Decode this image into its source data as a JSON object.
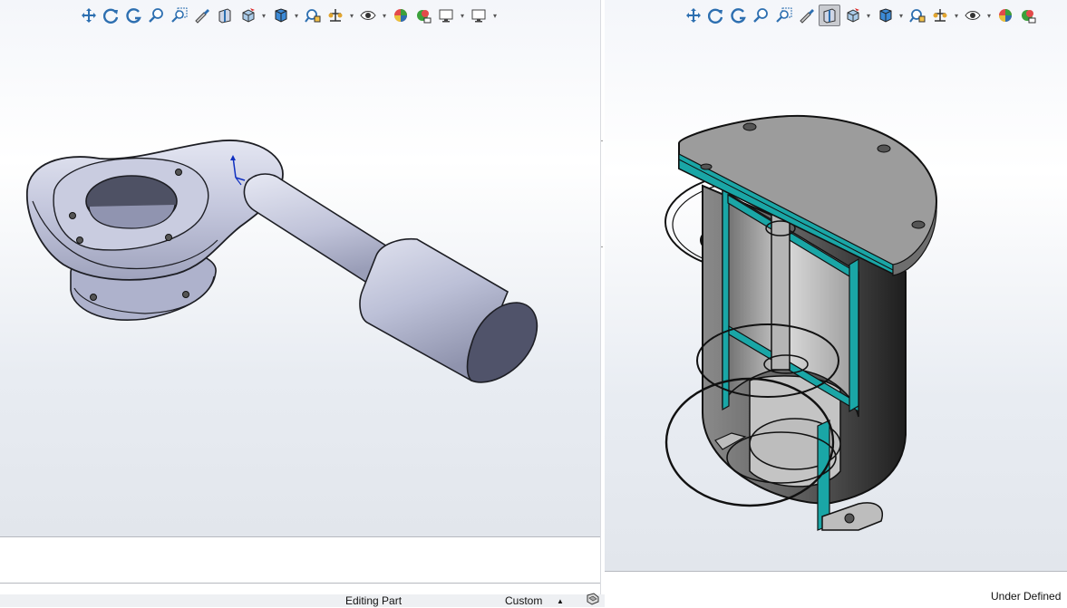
{
  "left_window": {
    "toolbar": {
      "buttons": [
        {
          "icon": "zoom-to-fit-icon"
        },
        {
          "icon": "rotate-view-icon"
        },
        {
          "icon": "previous-view-icon"
        },
        {
          "icon": "zoom-to-area-icon"
        },
        {
          "icon": "zoom-in-out-icon"
        },
        {
          "icon": "dynamic-annotation-icon"
        },
        {
          "icon": "section-view-icon"
        },
        {
          "icon": "view-selector-icon"
        },
        {
          "icon": "display-style-icon"
        },
        {
          "icon": "view-orientation-icon"
        },
        {
          "icon": "hide-show-items-icon"
        },
        {
          "icon": "apply-scene-icon"
        },
        {
          "icon": "view-settings-icon"
        },
        {
          "icon": "edit-appearance-icon"
        },
        {
          "icon": "display-manager-icon"
        },
        {
          "icon": "monitor-icon"
        }
      ]
    },
    "status": {
      "editing": "Editing Part",
      "units": "Custom",
      "units_arrow": "▲"
    }
  },
  "right_window": {
    "toolbar": {
      "buttons": [
        {
          "icon": "zoom-to-fit-icon"
        },
        {
          "icon": "rotate-view-icon"
        },
        {
          "icon": "previous-view-icon"
        },
        {
          "icon": "zoom-to-area-icon"
        },
        {
          "icon": "zoom-in-out-icon"
        },
        {
          "icon": "dynamic-annotation-icon"
        },
        {
          "icon": "section-view-icon",
          "active": true
        },
        {
          "icon": "view-selector-icon"
        },
        {
          "icon": "display-style-icon"
        },
        {
          "icon": "view-orientation-icon"
        },
        {
          "icon": "hide-show-items-icon"
        },
        {
          "icon": "apply-scene-icon"
        },
        {
          "icon": "view-settings-icon"
        },
        {
          "icon": "edit-appearance-icon"
        }
      ]
    },
    "status": {
      "definition": "Under Defined"
    }
  },
  "colors": {
    "part_body": "#b9bdd6",
    "part_dark": "#4f5262",
    "section_fill": "#1aa6a6",
    "section_body": "#9c9c9c",
    "toolbar_blue": "#2d6fb0"
  }
}
